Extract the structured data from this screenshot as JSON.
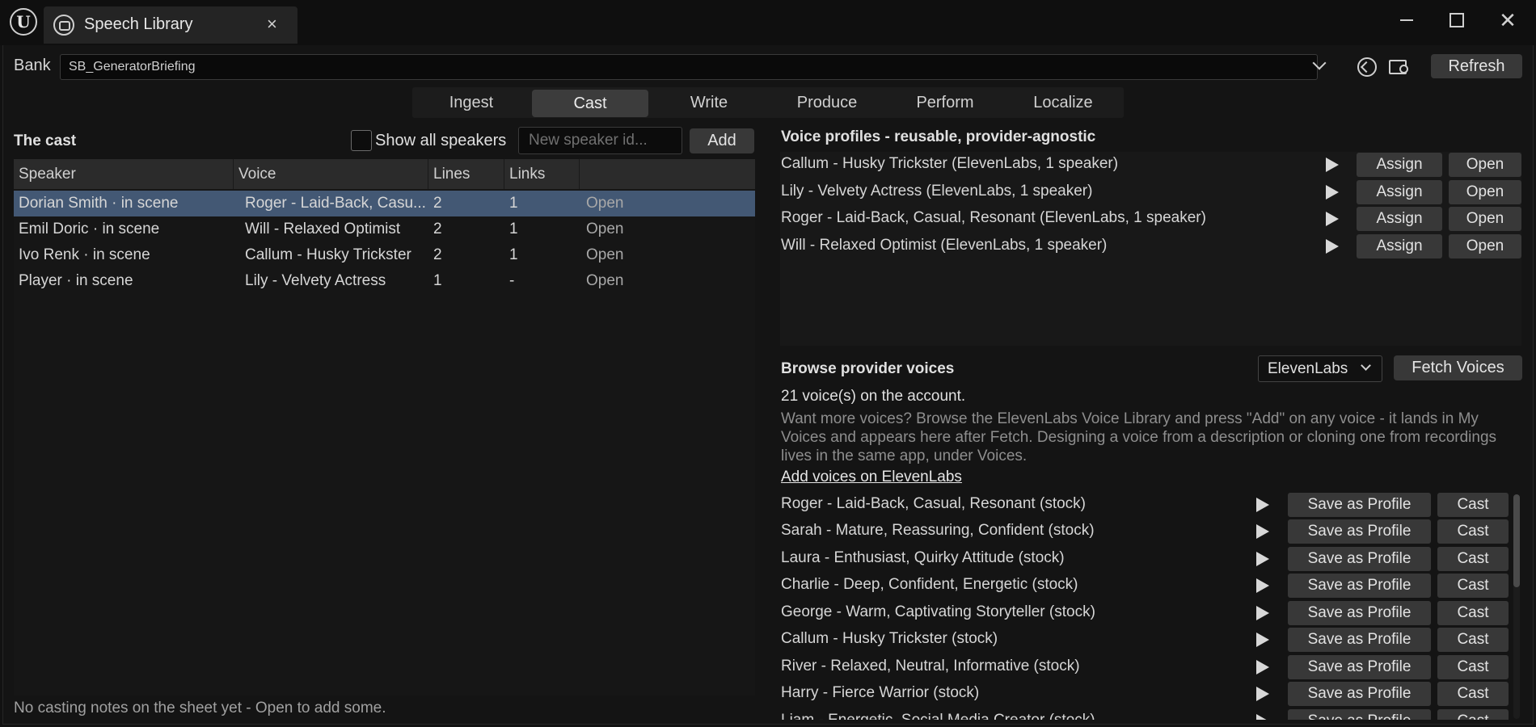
{
  "window": {
    "tab_title": "Speech Library",
    "close_glyph": "×",
    "win_close_glyph": "✕",
    "logo_letter": "U"
  },
  "bank": {
    "label": "Bank",
    "value": "SB_GeneratorBriefing",
    "refresh_label": "Refresh"
  },
  "modes": [
    {
      "label": "Ingest",
      "active": false
    },
    {
      "label": "Cast",
      "active": true
    },
    {
      "label": "Write",
      "active": false
    },
    {
      "label": "Produce",
      "active": false
    },
    {
      "label": "Perform",
      "active": false
    },
    {
      "label": "Localize",
      "active": false
    }
  ],
  "cast": {
    "title": "The cast",
    "show_all_label": "Show all speakers",
    "show_all_checked": false,
    "new_speaker_placeholder": "New speaker id...",
    "add_label": "Add",
    "columns": [
      "Speaker",
      "Voice",
      "Lines",
      "Links",
      ""
    ],
    "rows": [
      {
        "speaker": "Dorian Smith  · in scene",
        "voice": "Roger - Laid-Back, Casu...",
        "lines": "2",
        "links": "1",
        "action": "Open",
        "selected": true
      },
      {
        "speaker": "Emil Doric  · in scene",
        "voice": "Will - Relaxed Optimist",
        "lines": "2",
        "links": "1",
        "action": "Open",
        "selected": false
      },
      {
        "speaker": "Ivo Renk  · in scene",
        "voice": "Callum - Husky Trickster",
        "lines": "2",
        "links": "1",
        "action": "Open",
        "selected": false
      },
      {
        "speaker": "Player  · in scene",
        "voice": "Lily - Velvety Actress",
        "lines": "1",
        "links": "-",
        "action": "Open",
        "selected": false
      }
    ],
    "footer": "No casting notes on the sheet yet - Open to add some."
  },
  "profiles": {
    "title": "Voice profiles - reusable, provider-agnostic",
    "assign_label": "Assign",
    "open_label": "Open",
    "items": [
      "Callum - Husky Trickster  (ElevenLabs, 1 speaker)",
      "Lily - Velvety Actress  (ElevenLabs, 1 speaker)",
      "Roger - Laid-Back, Casual, Resonant  (ElevenLabs, 1 speaker)",
      "Will - Relaxed Optimist  (ElevenLabs, 1 speaker)"
    ]
  },
  "browse": {
    "title": "Browse provider voices",
    "provider": "ElevenLabs",
    "fetch_label": "Fetch Voices",
    "count_text": "21 voice(s) on the account.",
    "help_text": "Want more voices? Browse the ElevenLabs Voice Library and press \"Add\" on any voice - it lands in My Voices and appears here after Fetch. Designing a voice from a description or cloning one from recordings lives in the same app, under Voices.",
    "link_text": "Add voices on ElevenLabs",
    "save_label": "Save as Profile",
    "cast_label": "Cast",
    "voices": [
      "Roger - Laid-Back, Casual, Resonant  (stock)",
      "Sarah - Mature, Reassuring, Confident  (stock)",
      "Laura - Enthusiast, Quirky Attitude  (stock)",
      "Charlie - Deep, Confident, Energetic  (stock)",
      "George - Warm, Captivating Storyteller  (stock)",
      "Callum - Husky Trickster  (stock)",
      "River - Relaxed, Neutral, Informative  (stock)",
      "Harry - Fierce Warrior  (stock)",
      "Liam - Energetic, Social Media Creator  (stock)"
    ]
  },
  "colors": {
    "selection": "#435874",
    "background": "#141414",
    "button": "#383838"
  }
}
